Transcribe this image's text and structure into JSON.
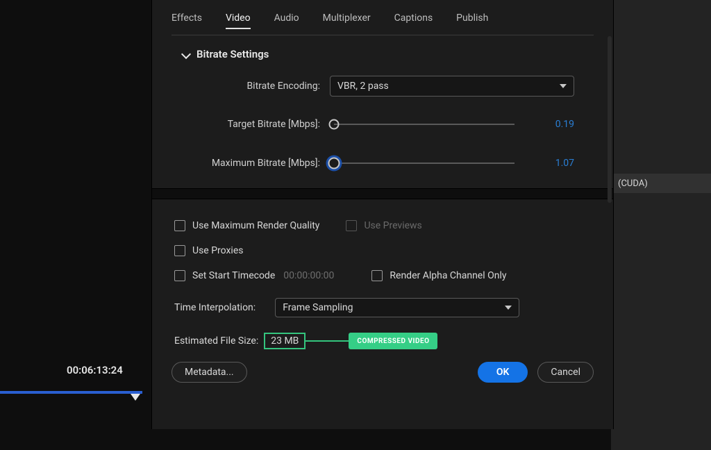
{
  "tabs": {
    "effects": "Effects",
    "video": "Video",
    "audio": "Audio",
    "multiplexer": "Multiplexer",
    "captions": "Captions",
    "publish": "Publish"
  },
  "bitrate": {
    "section_title": "Bitrate Settings",
    "encoding_label": "Bitrate Encoding:",
    "encoding_value": "VBR, 2 pass",
    "target_label": "Target Bitrate [Mbps]:",
    "target_value": "0.19",
    "max_label": "Maximum Bitrate [Mbps]:",
    "max_value": "1.07"
  },
  "options": {
    "use_max_render": "Use Maximum Render Quality",
    "use_previews": "Use Previews",
    "use_proxies": "Use Proxies",
    "set_start_tc": "Set Start Timecode",
    "start_tc_value": "00:00:00:00",
    "render_alpha": "Render Alpha Channel Only"
  },
  "time_interp": {
    "label": "Time Interpolation:",
    "value": "Frame Sampling"
  },
  "estimate": {
    "label": "Estimated File Size:",
    "value": "23 MB",
    "annotation": "COMPRESSED VIDEO"
  },
  "buttons": {
    "metadata": "Metadata...",
    "ok": "OK",
    "cancel": "Cancel"
  },
  "background": {
    "cuda_fragment": "(CUDA)",
    "timeline_tc": "00:06:13:24"
  }
}
